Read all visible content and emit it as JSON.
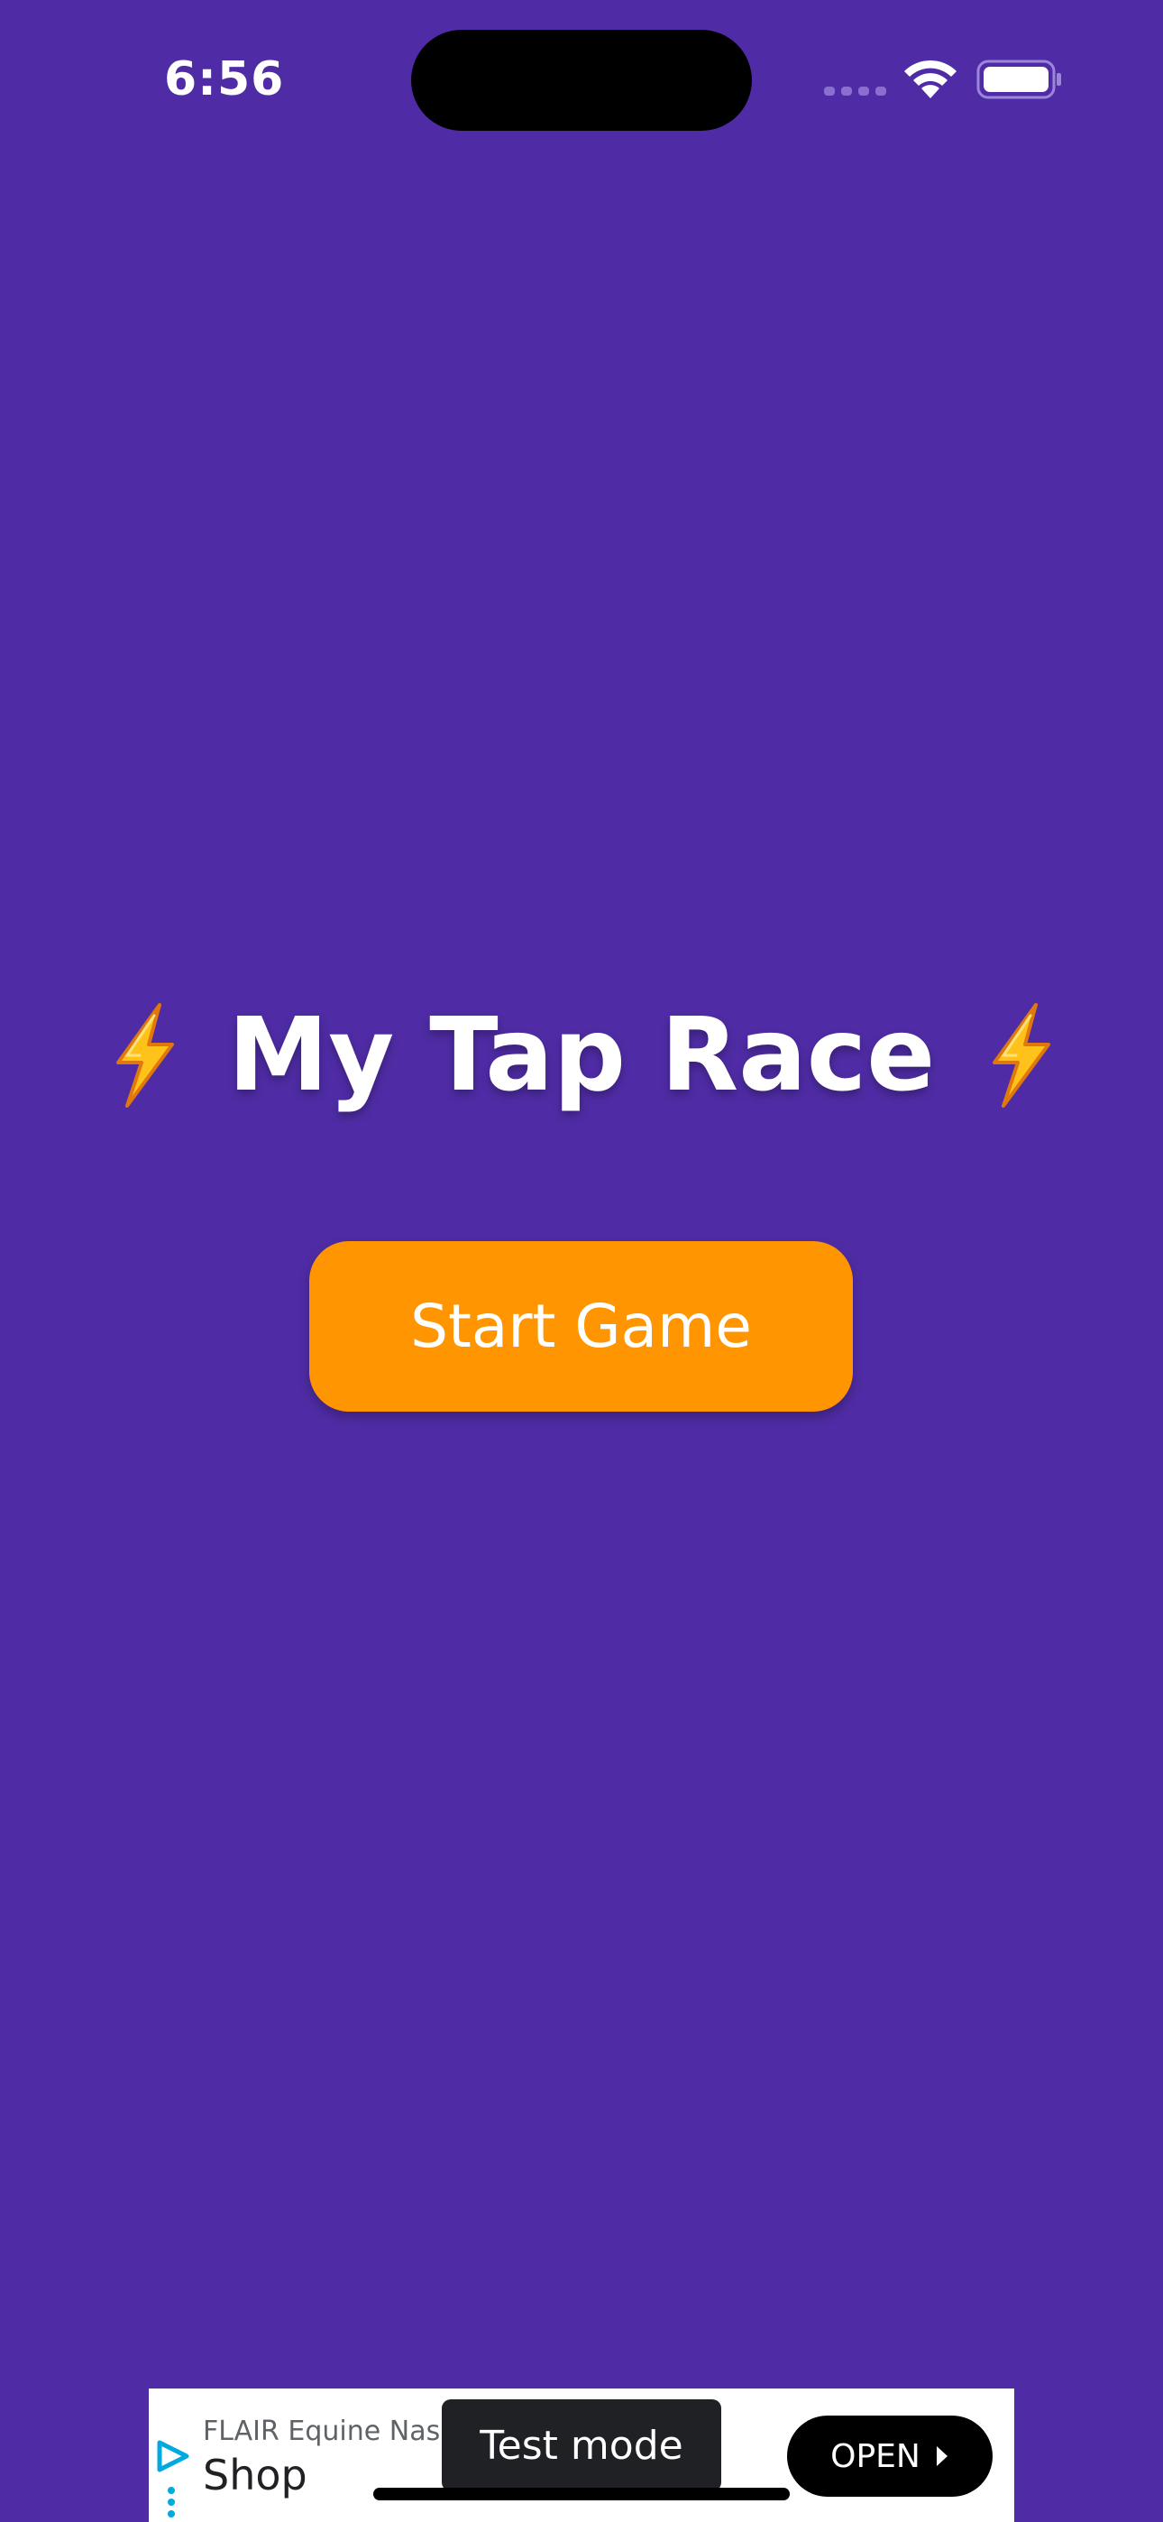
{
  "status_bar": {
    "time": "6:56",
    "icons": [
      "signal-icon",
      "wifi-icon",
      "battery-icon"
    ]
  },
  "main": {
    "title": "My Tap Race",
    "title_icon": "lightning-bolt-icon",
    "start_button_label": "Start Game"
  },
  "ad": {
    "advertiser": "FLAIR Equine Nasa",
    "headline": "Shop",
    "cta_label": "OPEN",
    "test_mode_label": "Test mode",
    "icons": [
      "ad-choices-play-icon",
      "more-dots-icon",
      "chevron-right-icon"
    ]
  },
  "colors": {
    "background": "#4F2CA5",
    "button": "#FF9500",
    "text": "#FFFFFF"
  }
}
